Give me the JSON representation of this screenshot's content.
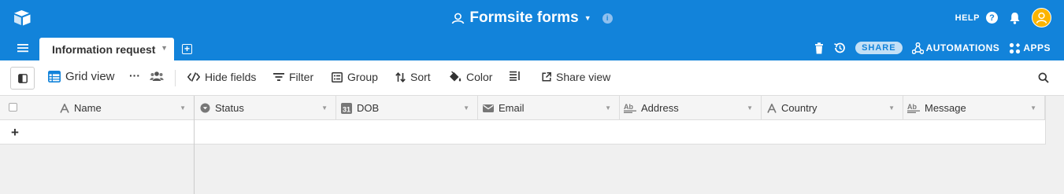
{
  "app": {
    "base_name": "Formsite forms",
    "help_label": "HELP"
  },
  "tabs": {
    "active": "Information request"
  },
  "tab_bar_right": {
    "share_label": "SHARE",
    "automations_label": "AUTOMATIONS",
    "apps_label": "APPS"
  },
  "toolbar": {
    "view_name": "Grid view",
    "more_label": "···",
    "hide_fields": "Hide fields",
    "filter": "Filter",
    "group": "Group",
    "sort": "Sort",
    "color": "Color",
    "share_view": "Share view"
  },
  "columns": [
    {
      "name": "Name",
      "icon": "text-icon"
    },
    {
      "name": "Status",
      "icon": "single-select-icon"
    },
    {
      "name": "DOB",
      "icon": "calendar-icon"
    },
    {
      "name": "Email",
      "icon": "email-icon"
    },
    {
      "name": "Address",
      "icon": "long-text-icon"
    },
    {
      "name": "Country",
      "icon": "text-icon"
    },
    {
      "name": "Message",
      "icon": "long-text-icon"
    }
  ],
  "grid": {
    "add_row_symbol": "+"
  },
  "colors": {
    "header_blue": "#1283da",
    "avatar_yellow": "#fcb400",
    "view_icon_blue": "#1283da"
  }
}
